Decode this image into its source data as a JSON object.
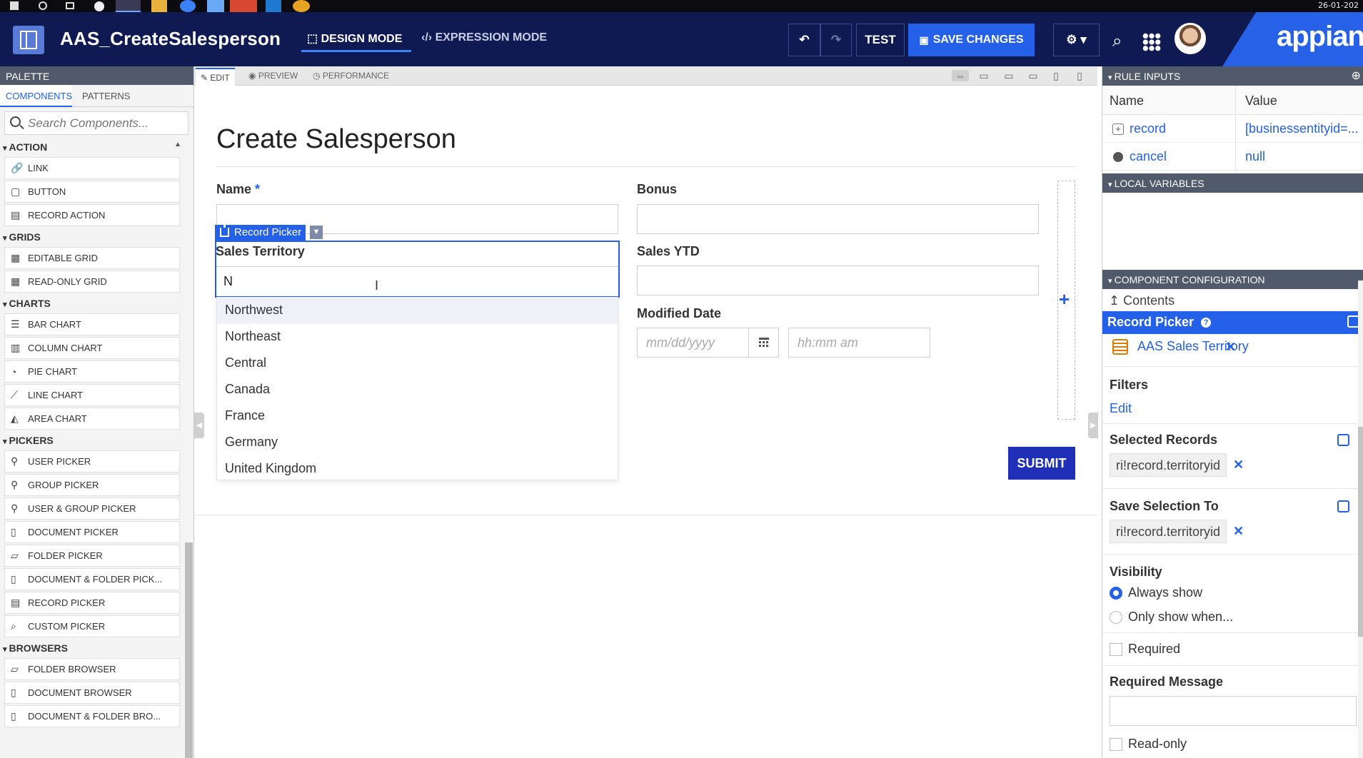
{
  "taskbar": {
    "date": "26-01-202"
  },
  "header": {
    "title": "AAS_CreateSalesperson",
    "modes": {
      "design": "DESIGN MODE",
      "expression": "EXPRESSION MODE"
    },
    "buttons": {
      "test": "TEST",
      "save": "SAVE CHANGES"
    },
    "brand": "appian"
  },
  "palette": {
    "title": "PALETTE",
    "tabs": {
      "components": "COMPONENTS",
      "patterns": "PATTERNS"
    },
    "search_placeholder": "Search Components...",
    "categories": [
      {
        "label": "ACTION",
        "items": [
          {
            "label": "LINK",
            "icon": "link-icon"
          },
          {
            "label": "BUTTON",
            "icon": "button-icon"
          },
          {
            "label": "RECORD ACTION",
            "icon": "record-action-icon"
          }
        ]
      },
      {
        "label": "GRIDS",
        "items": [
          {
            "label": "EDITABLE GRID",
            "icon": "editable-grid-icon"
          },
          {
            "label": "READ-ONLY GRID",
            "icon": "read-only-grid-icon"
          }
        ]
      },
      {
        "label": "CHARTS",
        "items": [
          {
            "label": "BAR CHART",
            "icon": "bar-chart-icon"
          },
          {
            "label": "COLUMN CHART",
            "icon": "column-chart-icon"
          },
          {
            "label": "PIE CHART",
            "icon": "pie-chart-icon"
          },
          {
            "label": "LINE CHART",
            "icon": "line-chart-icon"
          },
          {
            "label": "AREA CHART",
            "icon": "area-chart-icon"
          }
        ]
      },
      {
        "label": "PICKERS",
        "items": [
          {
            "label": "USER PICKER",
            "icon": "user-picker-icon"
          },
          {
            "label": "GROUP PICKER",
            "icon": "group-picker-icon"
          },
          {
            "label": "USER & GROUP PICKER",
            "icon": "user-group-picker-icon"
          },
          {
            "label": "DOCUMENT PICKER",
            "icon": "document-picker-icon"
          },
          {
            "label": "FOLDER PICKER",
            "icon": "folder-picker-icon"
          },
          {
            "label": "DOCUMENT & FOLDER PICK...",
            "icon": "document-folder-picker-icon"
          },
          {
            "label": "RECORD PICKER",
            "icon": "record-picker-icon"
          },
          {
            "label": "CUSTOM PICKER",
            "icon": "custom-picker-icon"
          }
        ]
      },
      {
        "label": "BROWSERS",
        "items": [
          {
            "label": "FOLDER BROWSER",
            "icon": "folder-browser-icon"
          },
          {
            "label": "DOCUMENT BROWSER",
            "icon": "document-browser-icon"
          },
          {
            "label": "DOCUMENT & FOLDER BRO...",
            "icon": "document-folder-browser-icon"
          }
        ]
      }
    ]
  },
  "canvas": {
    "tabs": {
      "edit": "EDIT",
      "preview": "PREVIEW",
      "performance": "PERFORMANCE"
    },
    "form_title": "Create Salesperson",
    "fields": {
      "name": {
        "label": "Name",
        "required_mark": "*"
      },
      "bonus": {
        "label": "Bonus"
      },
      "sales_ytd": {
        "label": "Sales YTD"
      },
      "modified_date": {
        "label": "Modified Date",
        "date_placeholder": "mm/dd/yyyy",
        "time_placeholder": "hh:mm am"
      },
      "sales_territory": {
        "label": "Sales Territory",
        "value": "N"
      }
    },
    "selected_component_tag": "Record Picker",
    "dropdown_options": [
      "Northwest",
      "Northeast",
      "Central",
      "Canada",
      "France",
      "Germany",
      "United Kingdom"
    ],
    "submit": "SUBMIT"
  },
  "right_panel": {
    "rule_inputs": {
      "title": "RULE INPUTS",
      "columns": {
        "name": "Name",
        "value": "Value"
      },
      "rows": [
        {
          "name": "record",
          "value": "[businessentityid=..."
        },
        {
          "name": "cancel",
          "value": "null"
        }
      ]
    },
    "local_variables": {
      "title": "LOCAL VARIABLES"
    },
    "component_configuration": {
      "title": "COMPONENT CONFIGURATION",
      "contents": "Contents",
      "component": "Record Picker",
      "record_type": "AAS Sales Territory",
      "filters": {
        "label": "Filters",
        "edit": "Edit"
      },
      "selected_records": {
        "label": "Selected Records",
        "value": "ri!record.territoryid"
      },
      "save_selection_to": {
        "label": "Save Selection To",
        "value": "ri!record.territoryid"
      },
      "visibility": {
        "label": "Visibility",
        "always": "Always show",
        "only": "Only show when..."
      },
      "required": "Required",
      "required_message": "Required Message",
      "read_only": "Read-only"
    }
  },
  "colors": {
    "accent": "#2461e8",
    "header": "#101a52",
    "submit": "#1f2fb8"
  }
}
